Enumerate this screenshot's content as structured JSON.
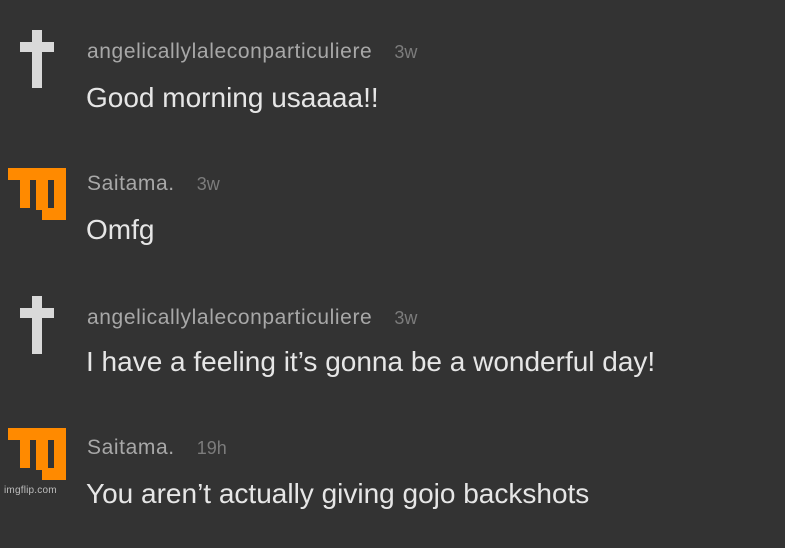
{
  "comments": [
    {
      "username": "angelicallylaleconparticuliere",
      "time": "3w",
      "text": "Good morning usaaaa!!",
      "avatar_icon": "cross-icon"
    },
    {
      "username": "Saitama.",
      "time": "3w",
      "text": "Omfg",
      "avatar_icon": "orange-m-logo-icon"
    },
    {
      "username": "angelicallylaleconparticuliere",
      "time": "3w",
      "text": "I have a feeling it’s gonna be a wonderful day!",
      "avatar_icon": "cross-icon"
    },
    {
      "username": "Saitama.",
      "time": "19h",
      "text": "You aren’t actually giving gojo backshots",
      "avatar_icon": "orange-m-logo-icon"
    }
  ],
  "watermark": "imgflip.com",
  "colors": {
    "background": "#333333",
    "username": "#a8a8a8",
    "time": "#7c7c7c",
    "text": "#e6e6e6",
    "cross": "#d9d9d9",
    "logo_orange": "#ff8a00"
  }
}
